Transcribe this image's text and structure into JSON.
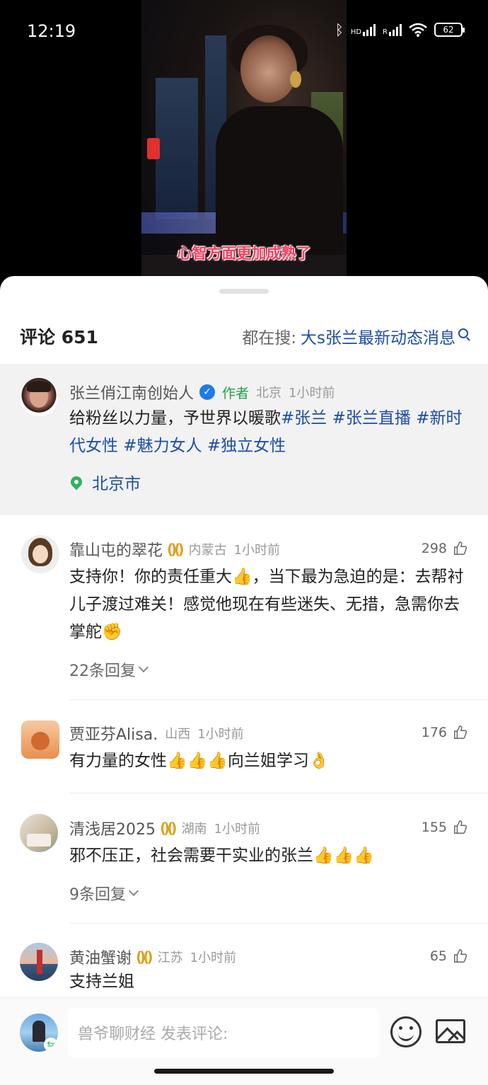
{
  "status": {
    "time": "12:19",
    "battery": "62",
    "net1": "HD",
    "net2": "R"
  },
  "video": {
    "subtitle": "心智方面更加成熟了"
  },
  "header": {
    "count_label": "评论 651",
    "hot_prefix": "都在搜:",
    "hot_keyword": "大s张兰最新动态消息"
  },
  "pinned": {
    "user": "张兰俏江南创始人",
    "badge": "作者",
    "region": "北京",
    "time": "1小时前",
    "text_plain": "给粉丝以力量，予世界以暖歌",
    "tags": [
      "#张兰",
      " #张兰直播",
      " #新时代女性",
      " #魅力女人",
      " #独立女性"
    ],
    "location": "北京市"
  },
  "comments": [
    {
      "user": "靠山屯的翠花",
      "region": "内蒙古",
      "time": "1小时前",
      "likes": "298",
      "text": "支持你！你的责任重大👍，当下最为急迫的是：去帮衬儿子渡过难关！感觉他现在有些迷失、无措，急需你去掌舵✊",
      "replies": "22条回复"
    },
    {
      "user": "贾亚芬Alisa.",
      "region": "山西",
      "time": "1小时前",
      "likes": "176",
      "text": "有力量的女性👍👍👍向兰姐学习👌"
    },
    {
      "user": "清浅居2025",
      "region": "湖南",
      "time": "1小时前",
      "likes": "155",
      "text": "邪不压正，社会需要干实业的张兰👍👍👍",
      "replies": "9条回复"
    },
    {
      "user": "黄油蟹谢",
      "region": "江苏",
      "time": "1小时前",
      "likes": "65",
      "text": "支持兰姐"
    }
  ],
  "composer": {
    "placeholder": "兽爷聊财经 发表评论:"
  },
  "colors": {
    "accent": "#1c4ea6",
    "author": "#20a04a",
    "subtitle": "#ff3b5c"
  }
}
